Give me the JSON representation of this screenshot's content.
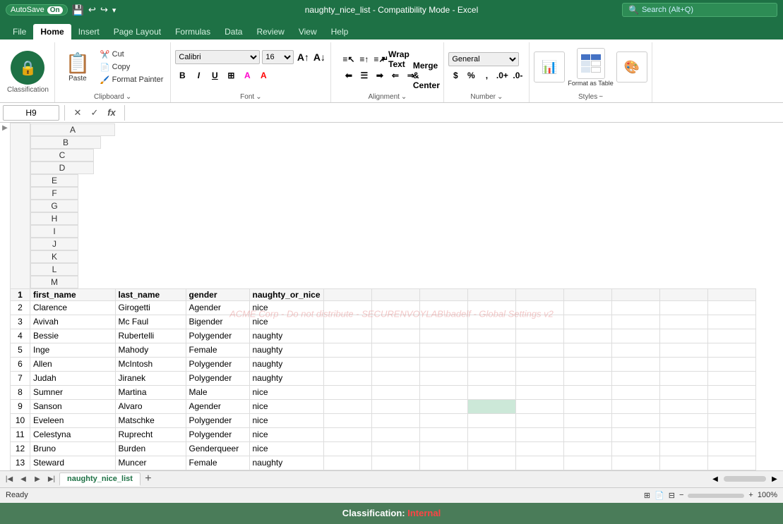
{
  "titlebar": {
    "autosave": "AutoSave",
    "autosave_state": "On",
    "filename": "naughty_nice_list",
    "mode": "Compatibility Mode",
    "app": "Excel",
    "search_placeholder": "Search (Alt+Q)"
  },
  "tabs": [
    "File",
    "Home",
    "Insert",
    "Page Layout",
    "Formulas",
    "Data",
    "Review",
    "View",
    "Help"
  ],
  "active_tab": "Home",
  "ribbon": {
    "clipboard": {
      "label": "Clipboard",
      "paste": "Paste",
      "cut": "Cut",
      "copy": "Copy",
      "format_painter": "Format Painter"
    },
    "font": {
      "label": "Font",
      "font_name": "Calibri",
      "font_size": "16",
      "bold": "B",
      "italic": "I",
      "underline": "U"
    },
    "alignment": {
      "label": "Alignment",
      "wrap_text": "Wrap Text",
      "merge_center": "Merge & Center"
    },
    "number": {
      "label": "Number",
      "format": "General"
    },
    "styles": {
      "label": "Styles",
      "conditional_formatting": "Conditional Formatting",
      "format_as_table": "Format as Table",
      "cell_styles": "Cell Styles"
    }
  },
  "formula_bar": {
    "cell_ref": "H9",
    "formula": ""
  },
  "columns": [
    "A",
    "B",
    "C",
    "D",
    "E",
    "F",
    "G",
    "H",
    "I",
    "J",
    "K",
    "L",
    "M"
  ],
  "spreadsheet": {
    "headers": [
      "first_name",
      "last_name",
      "gender",
      "naughty_or_nice",
      "",
      "",
      "",
      "",
      "",
      "",
      "",
      "",
      ""
    ],
    "rows": [
      [
        "Clarence",
        "Girogetti",
        "Agender",
        "nice",
        "",
        "",
        "",
        "",
        "",
        "",
        "",
        "",
        ""
      ],
      [
        "Avivah",
        "Mc Faul",
        "Bigender",
        "nice",
        "",
        "",
        "",
        "",
        "",
        "",
        "",
        "",
        ""
      ],
      [
        "Bessie",
        "Rubertelli",
        "Polygender",
        "naughty",
        "",
        "",
        "",
        "",
        "",
        "",
        "",
        "",
        ""
      ],
      [
        "Inge",
        "Mahody",
        "Female",
        "naughty",
        "",
        "",
        "",
        "",
        "",
        "",
        "",
        "",
        ""
      ],
      [
        "Allen",
        "McIntosh",
        "Polygender",
        "naughty",
        "",
        "",
        "",
        "",
        "",
        "",
        "",
        "",
        ""
      ],
      [
        "Judah",
        "Jiranek",
        "Polygender",
        "naughty",
        "",
        "",
        "",
        "",
        "",
        "",
        "",
        "",
        ""
      ],
      [
        "Sumner",
        "Martina",
        "Male",
        "nice",
        "",
        "",
        "",
        "",
        "",
        "",
        "",
        "",
        ""
      ],
      [
        "Sanson",
        "Alvaro",
        "Agender",
        "nice",
        "",
        "",
        "",
        "",
        "",
        "",
        "",
        "",
        ""
      ],
      [
        "Eveleen",
        "Matschke",
        "Polygender",
        "nice",
        "",
        "",
        "",
        "",
        "",
        "",
        "",
        "",
        ""
      ],
      [
        "Celestyna",
        "Ruprecht",
        "Polygender",
        "nice",
        "",
        "",
        "",
        "",
        "",
        "",
        "",
        "",
        ""
      ],
      [
        "Bruno",
        "Burden",
        "Genderqueer",
        "nice",
        "",
        "",
        "",
        "",
        "",
        "",
        "",
        "",
        ""
      ],
      [
        "Steward",
        "Muncer",
        "Female",
        "naughty",
        "",
        "",
        "",
        "",
        "",
        "",
        "",
        "",
        ""
      ]
    ]
  },
  "watermark": "ACME Corp - Do not distribute - SECURENVOYLAB\\badelf - Global Settings v2",
  "sheet_tab": "naughty_nice_list",
  "status": "Ready",
  "classification_banner": {
    "label": "Classification:",
    "value": "Internal"
  }
}
